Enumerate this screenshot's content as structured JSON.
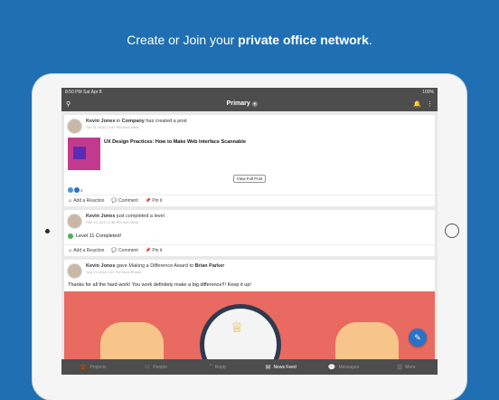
{
  "headline": {
    "prefix": "Create or Join your ",
    "bold": "private office network",
    "suffix": "."
  },
  "status": {
    "time": "8:50 PM",
    "date": "Sat Apr 8",
    "battery": "100%"
  },
  "topbar": {
    "title": "Primary"
  },
  "posts": [
    {
      "author": "Kevin Jones",
      "in_word": " in ",
      "group": "Company",
      "action": " has created a post",
      "meta": "Oct 11 2016 12:57 PM from Web",
      "title": "UX Design Practices: How to Make Web Interface Scannable",
      "view_full": "View Full Post",
      "reaction_count": "2",
      "actions": [
        "Add a Reaction",
        "Comment",
        "Pin it"
      ]
    },
    {
      "author": "Kevin Jones",
      "action": " just completed a level",
      "meta": "Feb 13, 2017 1:38 PM from Web",
      "level_text": "Level 11 Completed!",
      "actions": [
        "Add a Reaction",
        "Comment",
        "Pin it"
      ]
    },
    {
      "author": "Kevin Jones",
      "action": " gave Making a Difference Award to ",
      "recipient": "Brian Parker",
      "meta": "Sep 21 2016 1:52 PM from iPhone",
      "message": "Thanks for all the hard work! You work definitely make a big difference!!! Keep it up!"
    }
  ],
  "tabs": [
    "Projects",
    "People",
    "Reply",
    "News Feed",
    "Messages",
    "More"
  ],
  "colors": {
    "background": "#1f6fb2",
    "bar": "#4d4d4d",
    "accent": "#2a72c4",
    "award": "#e96a60"
  }
}
